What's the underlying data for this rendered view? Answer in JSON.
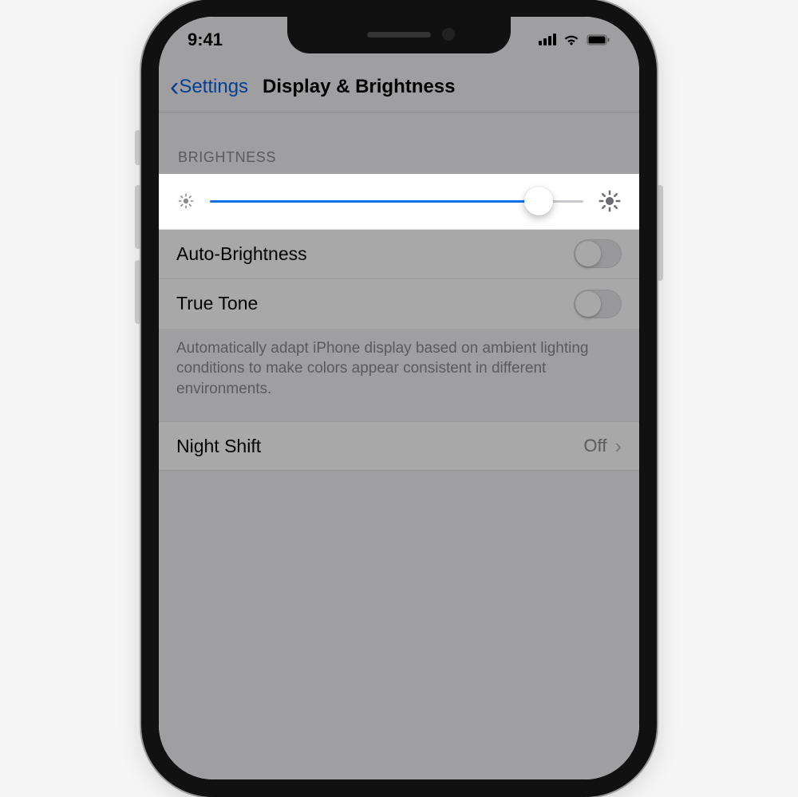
{
  "status": {
    "time": "9:41"
  },
  "nav": {
    "back_label": "Settings",
    "title": "Display & Brightness"
  },
  "brightness": {
    "section_header": "BRIGHTNESS",
    "slider_percent": 88,
    "auto_brightness_label": "Auto-Brightness",
    "auto_brightness_on": false,
    "true_tone_label": "True Tone",
    "true_tone_on": false,
    "footer_note": "Automatically adapt iPhone display based on ambient lighting conditions to make colors appear consistent in different environments."
  },
  "night_shift": {
    "label": "Night Shift",
    "value": "Off"
  },
  "colors": {
    "link": "#0a5fe0",
    "slider_fill": "#1072e8"
  }
}
